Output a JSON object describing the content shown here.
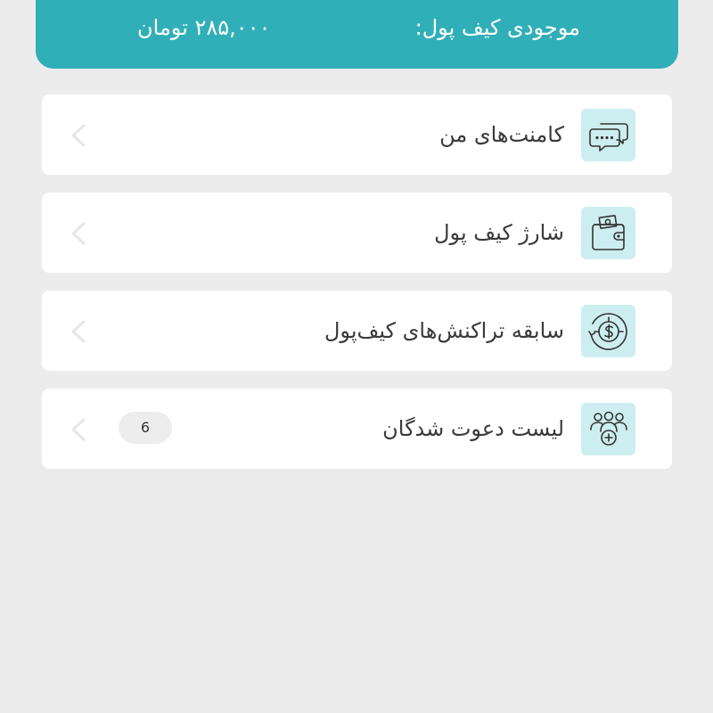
{
  "wallet": {
    "label": "موجودی کیف پول:",
    "amount": "۲۸۵,۰۰۰ تومان"
  },
  "menu": {
    "items": [
      {
        "label": "کامنت‌های من",
        "icon": "comments-icon"
      },
      {
        "label": "شارژ کیف پول",
        "icon": "wallet-icon"
      },
      {
        "label": "سابقه تراکنش‌های کیف‌پول",
        "icon": "transaction-history-icon"
      },
      {
        "label": "لیست دعوت شدگان",
        "icon": "invited-users-icon",
        "badge": "6"
      }
    ]
  },
  "colors": {
    "accent": "#31afb8",
    "icon_bg": "#cdeef0",
    "background": "#ececec"
  }
}
